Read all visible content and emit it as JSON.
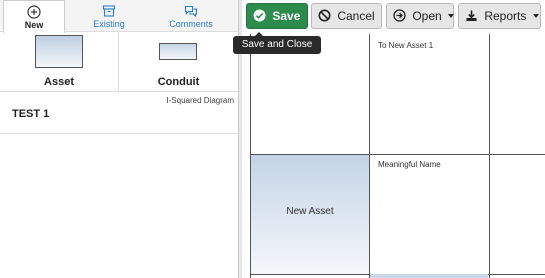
{
  "tabs": [
    {
      "label": "New",
      "icon": "plus-circle-icon"
    },
    {
      "label": "Existing",
      "icon": "archive-icon"
    },
    {
      "label": "Comments",
      "icon": "comments-icon"
    }
  ],
  "palette": {
    "asset_label": "Asset",
    "conduit_label": "Conduit"
  },
  "diagram_type": "I-Squared Diagram",
  "list": {
    "title": "TEST 1"
  },
  "toolbar": {
    "save_label": "Save",
    "cancel_label": "Cancel",
    "open_label": "Open",
    "reports_label": "Reports"
  },
  "tooltip": "Save and Close",
  "canvas": {
    "cell_top_label": "To New Asset 1",
    "cell_mid_label": "Meaningful Name",
    "new_asset_label": "New Asset"
  },
  "colors": {
    "save_green": "#2e8b4e",
    "link_blue": "#2b7fc6"
  }
}
